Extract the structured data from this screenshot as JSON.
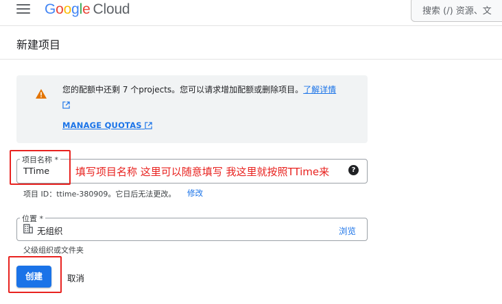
{
  "header": {
    "logo_google": [
      "G",
      "o",
      "o",
      "g",
      "l",
      "e"
    ],
    "logo_product": "Cloud",
    "search_placeholder": "搜索 (/) 资源、文"
  },
  "page": {
    "title": "新建项目"
  },
  "quota_notice": {
    "message": "您的配额中还剩 7 个projects。您可以请求增加配额或删除项目。",
    "learn_more": "了解详情",
    "manage_quotas": "MANAGE QUOTAS"
  },
  "form": {
    "name_label": "项目名称 *",
    "name_value": "TTime",
    "project_id_text": "项目 ID：ttime-380909。它日后无法更改。",
    "edit_label": "修改",
    "location_label": "位置 *",
    "location_value": "无组织",
    "browse_label": "浏览",
    "location_hint": "父级组织或文件夹",
    "create_label": "创建",
    "cancel_label": "取消"
  },
  "annotation": {
    "text": "填写项目名称 这里可以随意填写 我这里就按照TTime来"
  },
  "colors": {
    "accent": "#1a73e8",
    "annotation_red": "#e8211e",
    "warning": "#e37400"
  }
}
